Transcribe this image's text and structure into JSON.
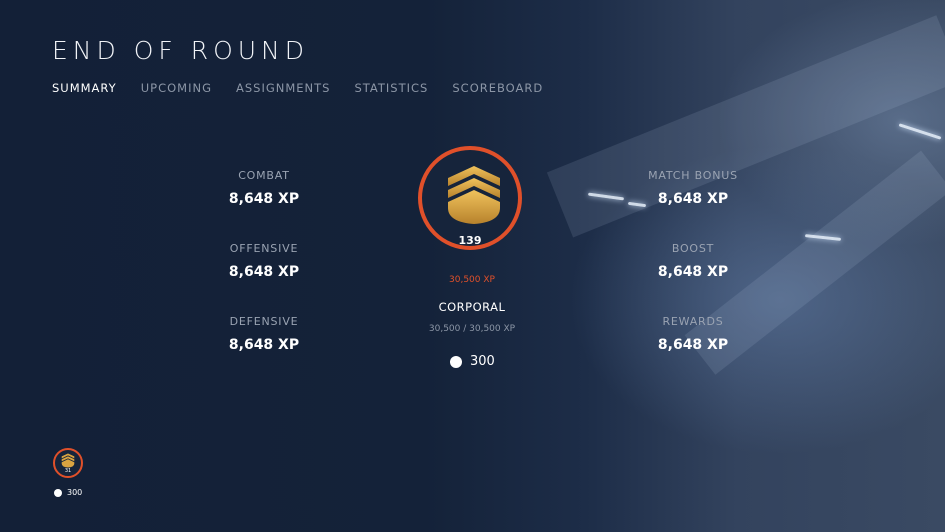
{
  "screen_title": "END OF ROUND",
  "tabs": [
    {
      "label": "SUMMARY",
      "active": true
    },
    {
      "label": "UPCOMING",
      "active": false
    },
    {
      "label": "ASSIGNMENTS",
      "active": false
    },
    {
      "label": "STATISTICS",
      "active": false
    },
    {
      "label": "SCOREBOARD",
      "active": false
    }
  ],
  "left_stats": [
    {
      "label": "COMBAT",
      "value": "8,648 XP"
    },
    {
      "label": "OFFENSIVE",
      "value": "8,648 XP"
    },
    {
      "label": "DEFENSIVE",
      "value": "8,648 XP"
    }
  ],
  "right_stats": [
    {
      "label": "MATCH BONUS",
      "value": "8,648 XP"
    },
    {
      "label": "BOOST",
      "value": "8,648 XP"
    },
    {
      "label": "REWARDS",
      "value": "8,648 XP"
    }
  ],
  "rank": {
    "number": "139",
    "xp_earned": "30,500 XP",
    "name": "CORPORAL",
    "progress_text": "30,500 / 30,500 XP",
    "progress_fraction": 1.0
  },
  "credits": {
    "value": "300"
  },
  "mini_rank": {
    "number": "31",
    "credits": "300"
  },
  "colors": {
    "accent": "#e0502a",
    "rank_gold": "#d9a441",
    "background": "#13213a"
  },
  "icons": {
    "rank": "chevron-rank-icon",
    "credits": "credit-dot-icon"
  }
}
